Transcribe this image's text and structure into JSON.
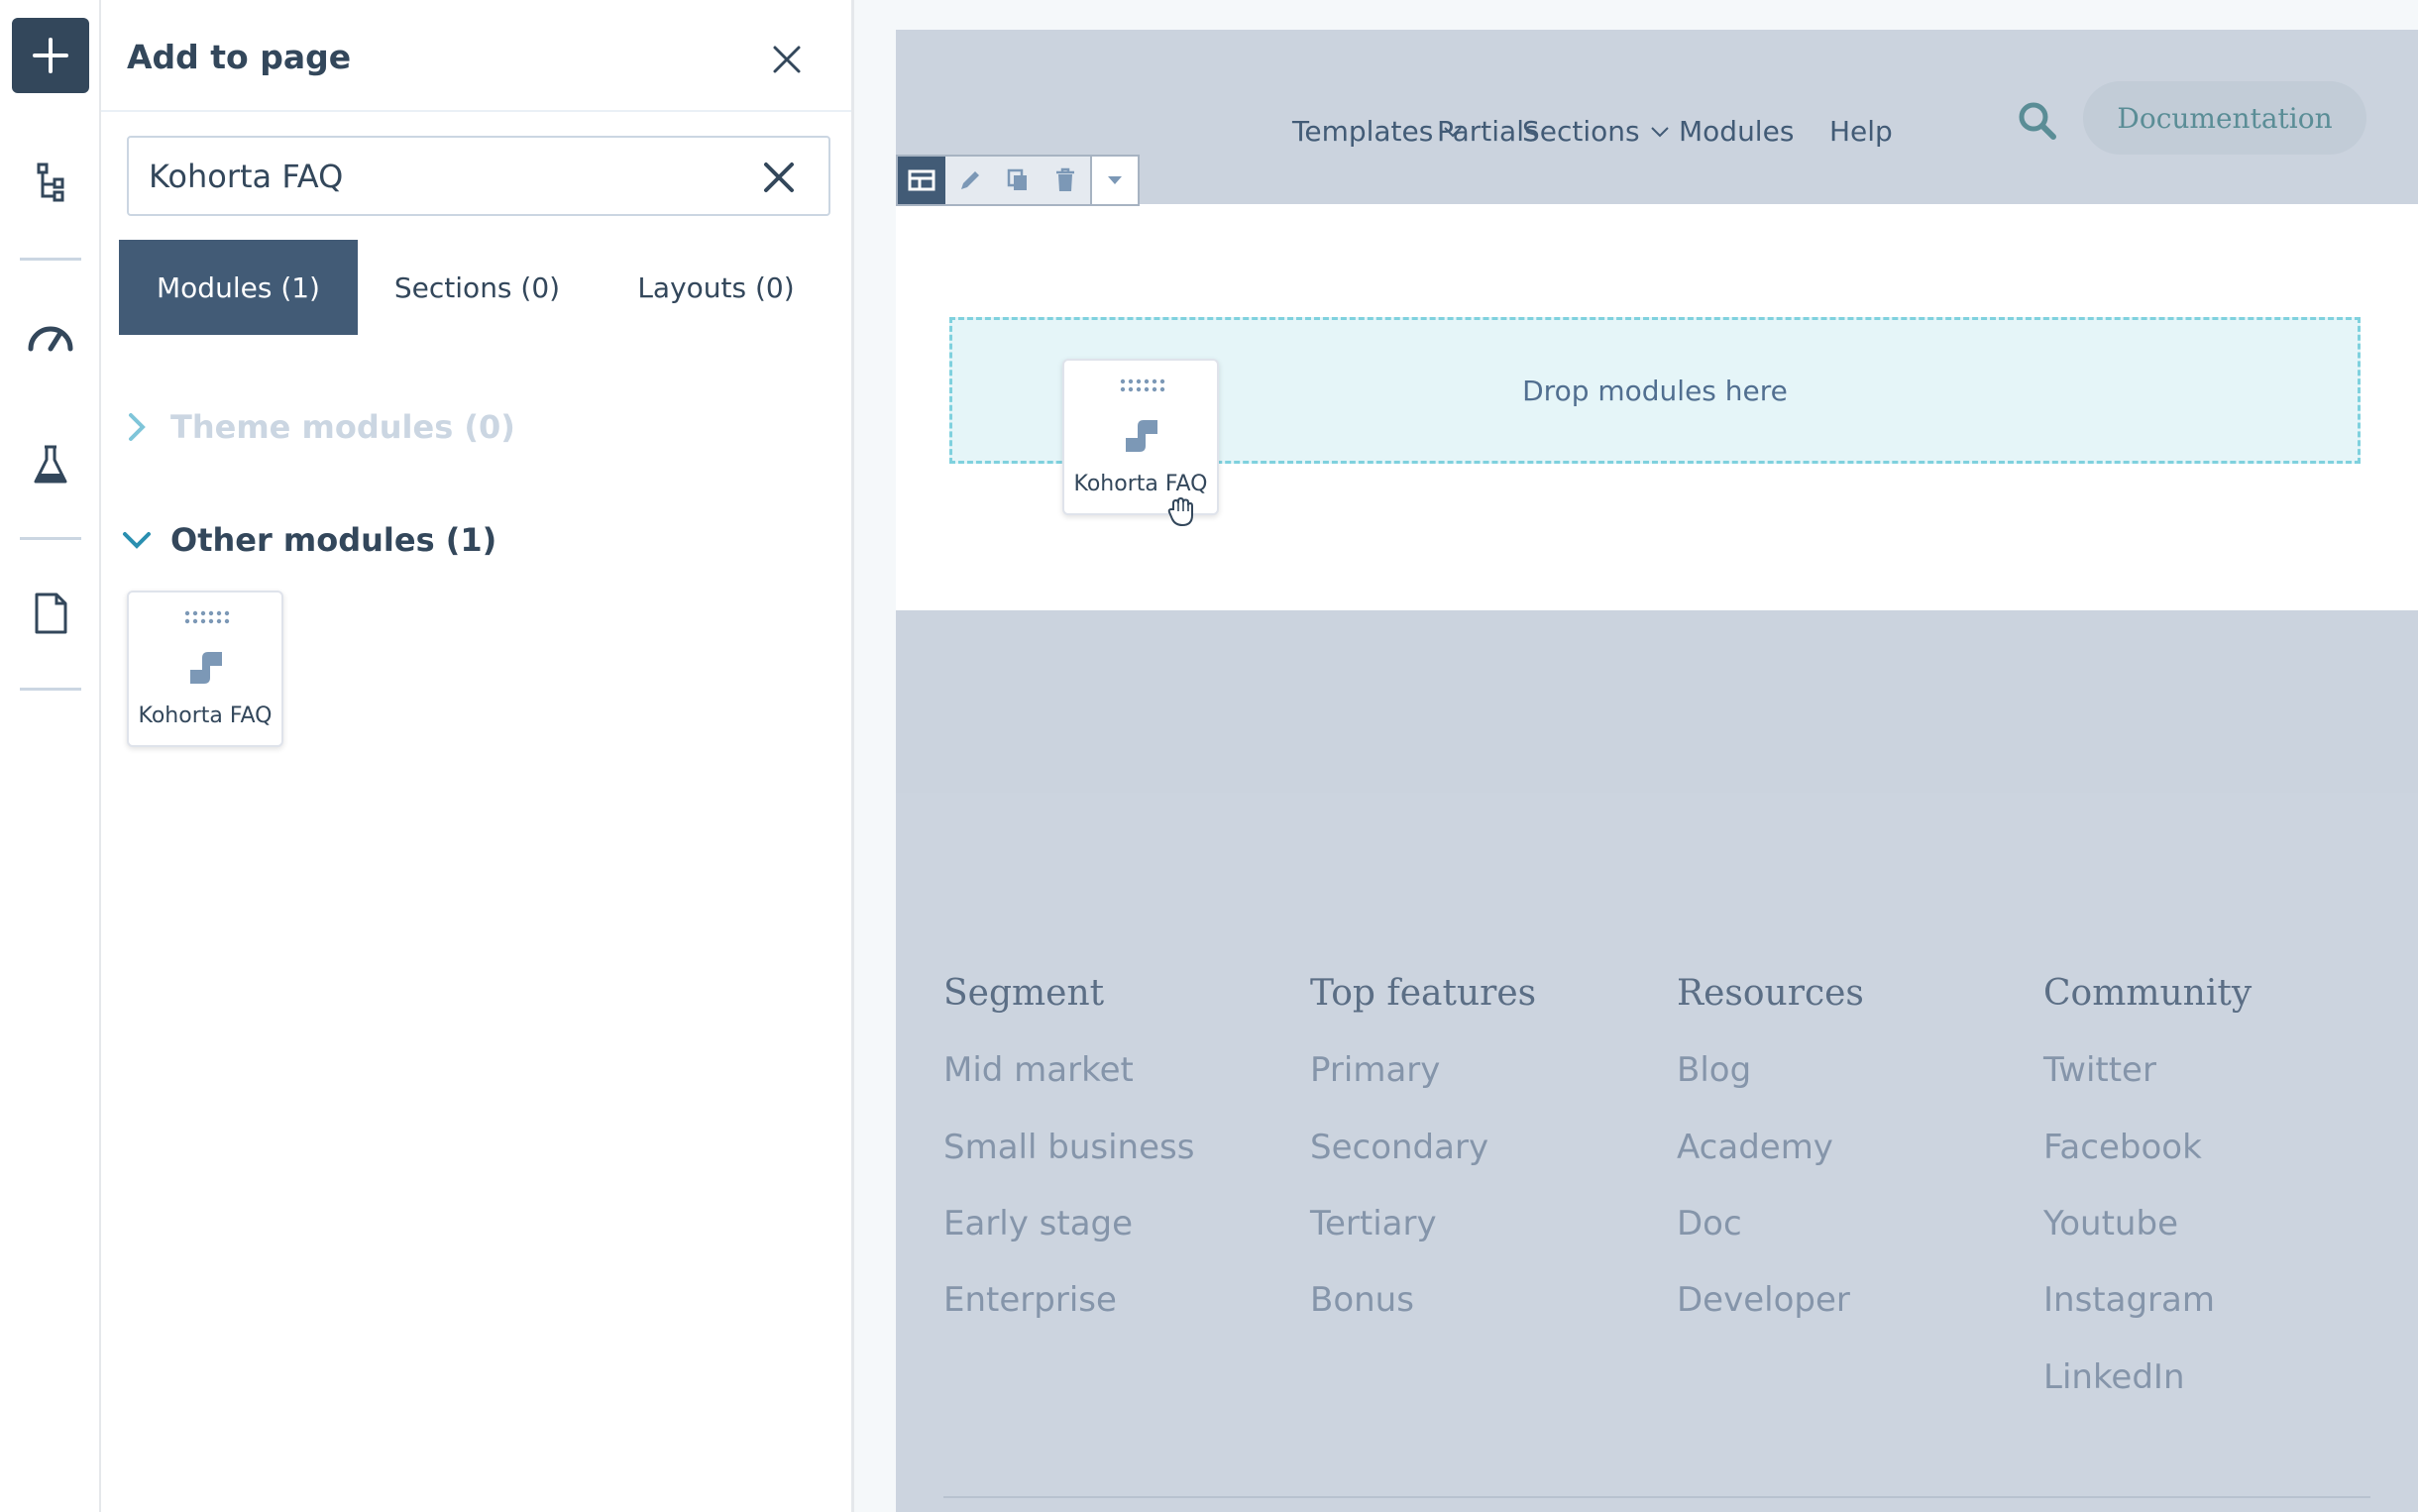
{
  "sidebar_rail": {
    "add_icon": "plus-icon",
    "icons": [
      "tree-structure-icon",
      "speedometer-icon",
      "flask-icon",
      "document-icon"
    ]
  },
  "panel": {
    "title": "Add to page",
    "search": {
      "value": "Kohorta FAQ",
      "placeholder": "Search"
    },
    "tabs": [
      {
        "label": "Modules (1)",
        "active": true
      },
      {
        "label": "Sections (0)",
        "active": false
      },
      {
        "label": "Layouts (0)",
        "active": false
      }
    ],
    "groups": {
      "theme": {
        "label": "Theme modules (0)",
        "expanded": false
      },
      "other": {
        "label": "Other modules (1)",
        "expanded": true
      }
    },
    "module_card": {
      "label": "Kohorta FAQ",
      "icon": "module-puzzle-icon"
    }
  },
  "preview": {
    "nav": {
      "items": [
        {
          "label": "Templates",
          "dropdown": true
        },
        {
          "label": "Partials",
          "dropdown": false
        },
        {
          "label": "Sections",
          "dropdown": true
        },
        {
          "label": "Modules",
          "dropdown": false
        },
        {
          "label": "Help",
          "dropdown": false
        }
      ],
      "search_icon": "search-icon",
      "cta": "Documentation"
    },
    "toolbar": [
      "layout-icon",
      "pencil-icon",
      "copy-icon",
      "trash-icon",
      "caret-down-icon"
    ],
    "dropzone": "Drop modules here",
    "dragging_card": {
      "label": "Kohorta FAQ"
    },
    "footer": {
      "columns": [
        {
          "heading": "Segment",
          "links": [
            "Mid market",
            "Small business",
            "Early stage",
            "Enterprise"
          ]
        },
        {
          "heading": "Top features",
          "links": [
            "Primary",
            "Secondary",
            "Tertiary",
            "Bonus"
          ]
        },
        {
          "heading": "Resources",
          "links": [
            "Blog",
            "Academy",
            "Doc",
            "Developer"
          ]
        },
        {
          "heading": "Community",
          "links": [
            "Twitter",
            "Facebook",
            "Youtube",
            "Instagram",
            "LinkedIn"
          ]
        }
      ]
    }
  },
  "colors": {
    "primary_dark": "#33475b",
    "tab_active": "#425b76",
    "dropzone_border": "#7fd1de",
    "preview_bg": "#cbd3de"
  }
}
